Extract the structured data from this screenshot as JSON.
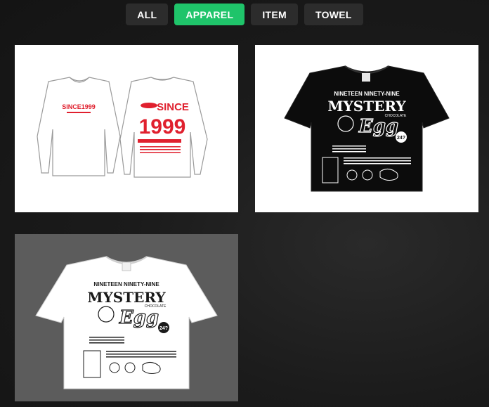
{
  "filters": [
    {
      "label": "ALL",
      "active": false
    },
    {
      "label": "APPAREL",
      "active": true
    },
    {
      "label": "ITEM",
      "active": false
    },
    {
      "label": "TOWEL",
      "active": false
    }
  ],
  "colors": {
    "accent": "#1fc46a",
    "button_bg": "#2c2c2c",
    "page_bg": "#1b1b1b"
  },
  "products": [
    {
      "name": "long-sleeve-tee-white",
      "front_text": "SINCE1999",
      "back_text_top": "SINCE",
      "back_text_big": "1999"
    },
    {
      "name": "tee-black",
      "headline": "NINETEEN NINETY-NINE",
      "title_1": "MYSTERY",
      "title_2": "Egg",
      "subtitle": "CHOCOLATE",
      "badge": "24?"
    },
    {
      "name": "tee-white",
      "headline": "NINETEEN NINETY-NINE",
      "title_1": "MYSTERY",
      "title_2": "Egg",
      "subtitle": "CHOCOLATE",
      "badge": "24?"
    }
  ]
}
